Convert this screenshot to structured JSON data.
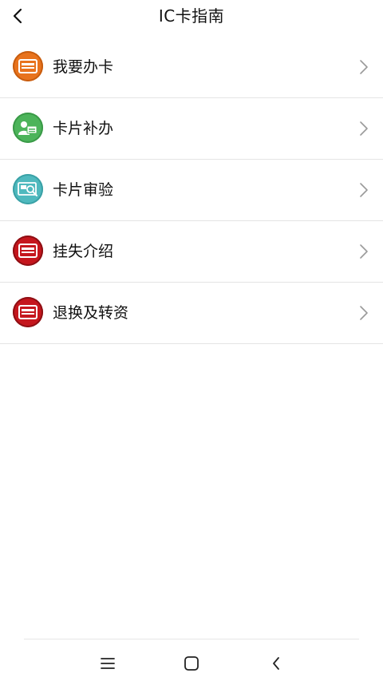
{
  "header": {
    "title": "IC卡指南",
    "back_icon": "chevron-left-icon"
  },
  "items": [
    {
      "label": "我要办卡",
      "icon": "card-icon",
      "color": "#E8731D"
    },
    {
      "label": "卡片补办",
      "icon": "user-card-icon",
      "color": "#4CB45A"
    },
    {
      "label": "卡片审验",
      "icon": "card-inspect-icon",
      "color": "#4FB9BE"
    },
    {
      "label": "挂失介绍",
      "icon": "card-icon",
      "color": "#C5161D"
    },
    {
      "label": "退换及转资",
      "icon": "card-icon",
      "color": "#C5161D"
    }
  ],
  "navbar": {
    "menu_icon": "menu-icon",
    "home_icon": "home-square-icon",
    "back_icon": "back-chevron-icon"
  }
}
